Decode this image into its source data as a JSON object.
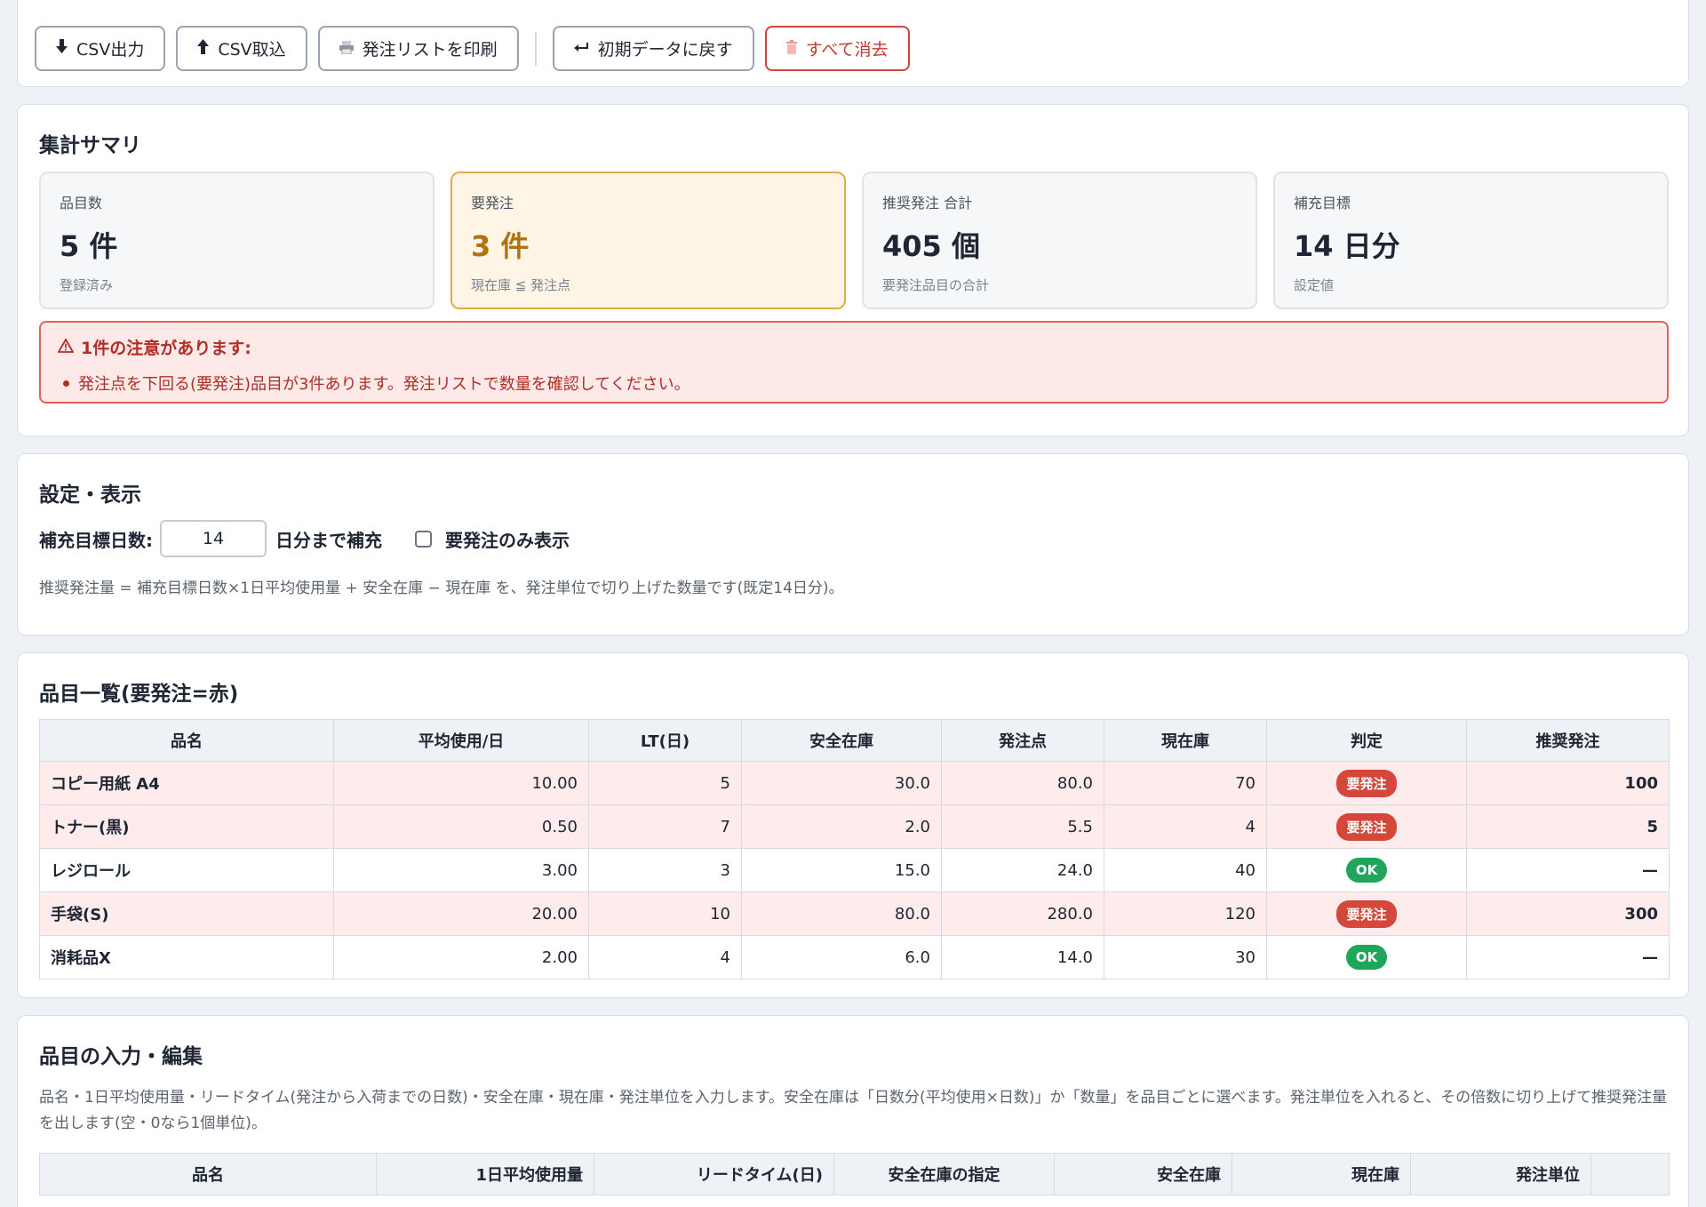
{
  "toolbar": {
    "csv_export": "CSV出力",
    "csv_import": "CSV取込",
    "print_list": "発注リストを印刷",
    "reset_defaults": "初期データに戻す",
    "clear_all": "すべて消去"
  },
  "summary": {
    "title": "集計サマリ",
    "stats": [
      {
        "label": "品目数",
        "value": "5 件",
        "note": "登録済み"
      },
      {
        "label": "要発注",
        "value": "3 件",
        "note": "現在庫 ≦ 発注点"
      },
      {
        "label": "推奨発注 合計",
        "value": "405 個",
        "note": "要発注品目の合計"
      },
      {
        "label": "補充目標",
        "value": "14 日分",
        "note": "設定値"
      }
    ],
    "alert_title": "1件の注意があります:",
    "alert_items": [
      "発注点を下回る(要発注)品目が3件あります。発注リストで数量を確認してください。"
    ]
  },
  "settings": {
    "title": "設定・表示",
    "target_days_label": "補充目標日数:",
    "target_days_value": "14",
    "target_days_suffix": "日分まで補充",
    "only_reorder_label": "要発注のみ表示",
    "only_reorder_checked": false,
    "help": "推奨発注量 = 補充目標日数×1日平均使用量 + 安全在庫 − 現在庫 を、発注単位で切り上げた数量です(既定14日分)。"
  },
  "items": {
    "title": "品目一覧(要発注=赤)",
    "columns": [
      "品名",
      "平均使用/日",
      "LT(日)",
      "安全在庫",
      "発注点",
      "現在庫",
      "判定",
      "推奨発注"
    ],
    "rows": [
      {
        "name": "コピー用紙 A4",
        "avg": "10.00",
        "lt": "5",
        "safety": "30.0",
        "reorder": "80.0",
        "stock": "70",
        "status": "要発注",
        "suggest": "100"
      },
      {
        "name": "トナー(黒)",
        "avg": "0.50",
        "lt": "7",
        "safety": "2.0",
        "reorder": "5.5",
        "stock": "4",
        "status": "要発注",
        "suggest": "5"
      },
      {
        "name": "レジロール",
        "avg": "3.00",
        "lt": "3",
        "safety": "15.0",
        "reorder": "24.0",
        "stock": "40",
        "status": "OK",
        "suggest": "—"
      },
      {
        "name": "手袋(S)",
        "avg": "20.00",
        "lt": "10",
        "safety": "80.0",
        "reorder": "280.0",
        "stock": "120",
        "status": "要発注",
        "suggest": "300"
      },
      {
        "name": "消耗品X",
        "avg": "2.00",
        "lt": "4",
        "safety": "6.0",
        "reorder": "14.0",
        "stock": "30",
        "status": "OK",
        "suggest": "—"
      }
    ]
  },
  "edit": {
    "title": "品目の入力・編集",
    "help": "品名・1日平均使用量・リードタイム(発注から入荷までの日数)・安全在庫・現在庫・発注単位を入力します。安全在庫は「日数分(平均使用×日数)」か「数量」を品目ごとに選べます。発注単位を入れると、その倍数に切り上げて推奨発注量を出します(空・0なら1個単位)。",
    "columns": [
      "品名",
      "1日平均使用量",
      "リードタイム(日)",
      "安全在庫の指定",
      "安全在庫",
      "現在庫",
      "発注単位",
      ""
    ]
  },
  "colors": {
    "alert_red": "#d4483c",
    "ok_green": "#1fa65a",
    "warn_amber": "#b07310",
    "row_highlight": "#fdeceb"
  },
  "icons": [
    "download-icon",
    "upload-icon",
    "printer-icon",
    "undo-icon",
    "trash-icon",
    "warning-icon"
  ]
}
